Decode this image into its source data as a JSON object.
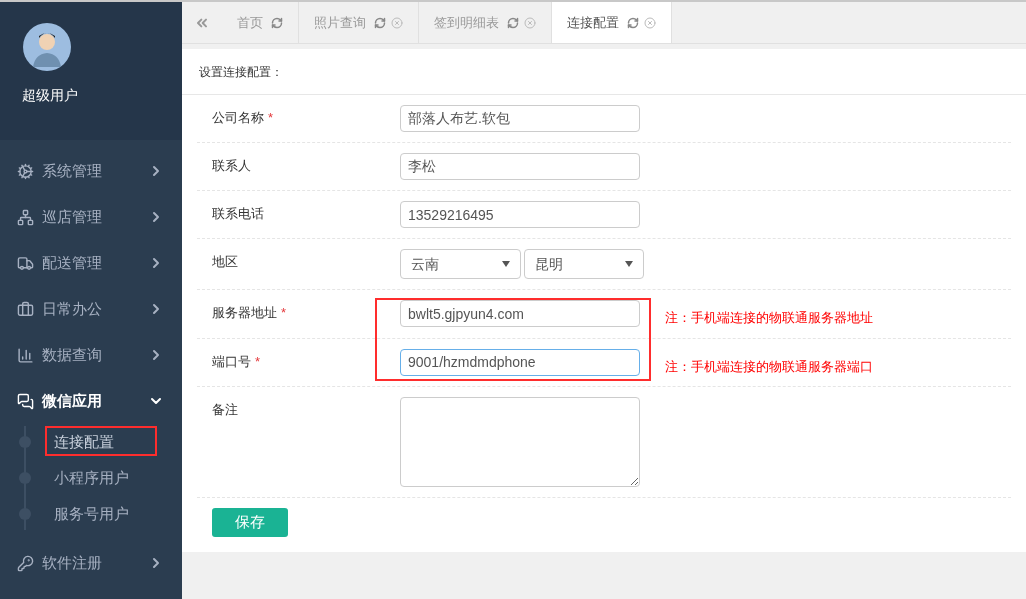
{
  "user": {
    "name": "超级用户"
  },
  "menu": [
    {
      "label": "系统管理",
      "expanded": false
    },
    {
      "label": "巡店管理",
      "expanded": false
    },
    {
      "label": "配送管理",
      "expanded": false
    },
    {
      "label": "日常办公",
      "expanded": false
    },
    {
      "label": "数据查询",
      "expanded": false
    },
    {
      "label": "微信应用",
      "expanded": true,
      "children": [
        {
          "label": "连接配置",
          "selected": true,
          "highlighted": true
        },
        {
          "label": "小程序用户",
          "selected": false,
          "highlighted": false
        },
        {
          "label": "服务号用户",
          "selected": false,
          "highlighted": false
        }
      ]
    },
    {
      "label": "软件注册",
      "expanded": false
    }
  ],
  "tabs": [
    {
      "label": "首页",
      "selected": false,
      "closable": false
    },
    {
      "label": "照片查询",
      "selected": false,
      "closable": true
    },
    {
      "label": "签到明细表",
      "selected": false,
      "closable": true
    },
    {
      "label": "连接配置",
      "selected": true,
      "closable": true
    }
  ],
  "form": {
    "title": "设置连接配置：",
    "fields": [
      {
        "kind": "text",
        "label": "公司名称",
        "required_mark": "*",
        "value": "部落人布艺.软包",
        "focused": false,
        "highlighted": false
      },
      {
        "kind": "text",
        "label": "联系人",
        "value": "李松",
        "focused": false,
        "highlighted": false
      },
      {
        "kind": "text",
        "label": "联系电话",
        "value": "13529216495",
        "focused": false,
        "highlighted": false
      },
      {
        "kind": "select",
        "label": "地区",
        "values": [
          "云南",
          "昆明"
        ],
        "focused": false,
        "highlighted": false
      },
      {
        "kind": "text",
        "label": "服务器地址",
        "required_mark": "*",
        "value": "bwlt5.gjpyun4.com",
        "note": "注：手机端连接的物联通服务器地址",
        "focused": false,
        "highlighted": true
      },
      {
        "kind": "text",
        "label": "端口号",
        "required_mark": "*",
        "value": "9001/hzmdmdphone",
        "note": "注：手机端连接的物联通服务器端口",
        "focused": true,
        "highlighted": true
      },
      {
        "kind": "textarea",
        "label": "备注",
        "focused": false,
        "highlighted": false
      }
    ],
    "save_button": "保存"
  }
}
